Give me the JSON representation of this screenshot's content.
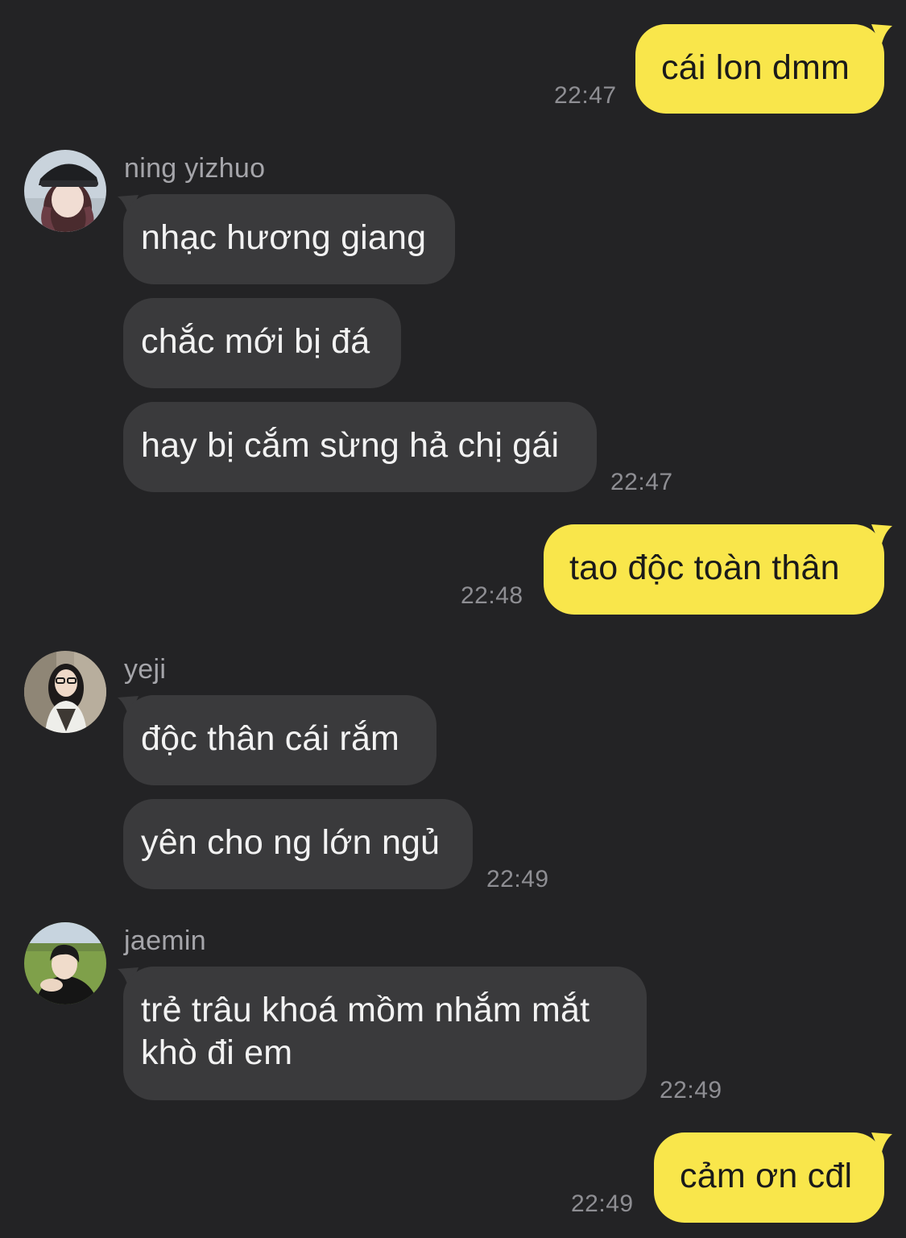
{
  "messages": [
    {
      "id": "m1",
      "direction": "outgoing",
      "text": "cái lon dmm",
      "time": "22:47"
    },
    {
      "id": "g1",
      "direction": "incoming",
      "sender": "ning yizhuo",
      "avatar": "avatar-ning-yizhuo",
      "texts": [
        "nhạc hương giang",
        "chắc mới bị đá",
        "hay bị cắm sừng hả chị gái"
      ],
      "time": "22:47"
    },
    {
      "id": "m2",
      "direction": "outgoing",
      "text": "tao độc toàn thân",
      "time": "22:48"
    },
    {
      "id": "g2",
      "direction": "incoming",
      "sender": "yeji",
      "avatar": "avatar-yeji",
      "texts": [
        "độc thân cái rắm",
        "yên cho ng lớn ngủ"
      ],
      "time": "22:49"
    },
    {
      "id": "g3",
      "direction": "incoming",
      "sender": "jaemin",
      "avatar": "avatar-jaemin",
      "texts": [
        "trẻ trâu khoá mồm nhắm mắt khò đi em"
      ],
      "time": "22:49"
    },
    {
      "id": "m3",
      "direction": "outgoing",
      "text": "cảm ơn cđl",
      "time": "22:49"
    }
  ],
  "colors": {
    "background": "#232325",
    "outgoing_bubble": "#f9e64b",
    "incoming_bubble": "#3a3a3c",
    "timestamp": "#8e8e93",
    "sender_name": "#a5a5aa"
  }
}
